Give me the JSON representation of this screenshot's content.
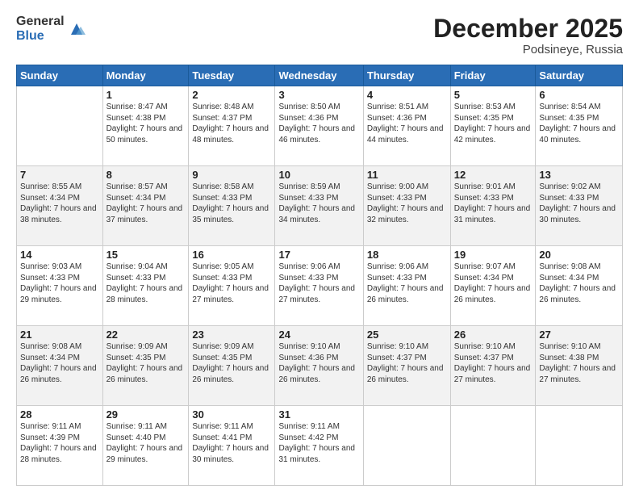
{
  "logo": {
    "general": "General",
    "blue": "Blue"
  },
  "header": {
    "month": "December 2025",
    "location": "Podsineye, Russia"
  },
  "days": [
    "Sunday",
    "Monday",
    "Tuesday",
    "Wednesday",
    "Thursday",
    "Friday",
    "Saturday"
  ],
  "weeks": [
    [
      {
        "day": "",
        "sunrise": "",
        "sunset": "",
        "daylight": ""
      },
      {
        "day": "1",
        "sunrise": "Sunrise: 8:47 AM",
        "sunset": "Sunset: 4:38 PM",
        "daylight": "Daylight: 7 hours and 50 minutes."
      },
      {
        "day": "2",
        "sunrise": "Sunrise: 8:48 AM",
        "sunset": "Sunset: 4:37 PM",
        "daylight": "Daylight: 7 hours and 48 minutes."
      },
      {
        "day": "3",
        "sunrise": "Sunrise: 8:50 AM",
        "sunset": "Sunset: 4:36 PM",
        "daylight": "Daylight: 7 hours and 46 minutes."
      },
      {
        "day": "4",
        "sunrise": "Sunrise: 8:51 AM",
        "sunset": "Sunset: 4:36 PM",
        "daylight": "Daylight: 7 hours and 44 minutes."
      },
      {
        "day": "5",
        "sunrise": "Sunrise: 8:53 AM",
        "sunset": "Sunset: 4:35 PM",
        "daylight": "Daylight: 7 hours and 42 minutes."
      },
      {
        "day": "6",
        "sunrise": "Sunrise: 8:54 AM",
        "sunset": "Sunset: 4:35 PM",
        "daylight": "Daylight: 7 hours and 40 minutes."
      }
    ],
    [
      {
        "day": "7",
        "sunrise": "Sunrise: 8:55 AM",
        "sunset": "Sunset: 4:34 PM",
        "daylight": "Daylight: 7 hours and 38 minutes."
      },
      {
        "day": "8",
        "sunrise": "Sunrise: 8:57 AM",
        "sunset": "Sunset: 4:34 PM",
        "daylight": "Daylight: 7 hours and 37 minutes."
      },
      {
        "day": "9",
        "sunrise": "Sunrise: 8:58 AM",
        "sunset": "Sunset: 4:33 PM",
        "daylight": "Daylight: 7 hours and 35 minutes."
      },
      {
        "day": "10",
        "sunrise": "Sunrise: 8:59 AM",
        "sunset": "Sunset: 4:33 PM",
        "daylight": "Daylight: 7 hours and 34 minutes."
      },
      {
        "day": "11",
        "sunrise": "Sunrise: 9:00 AM",
        "sunset": "Sunset: 4:33 PM",
        "daylight": "Daylight: 7 hours and 32 minutes."
      },
      {
        "day": "12",
        "sunrise": "Sunrise: 9:01 AM",
        "sunset": "Sunset: 4:33 PM",
        "daylight": "Daylight: 7 hours and 31 minutes."
      },
      {
        "day": "13",
        "sunrise": "Sunrise: 9:02 AM",
        "sunset": "Sunset: 4:33 PM",
        "daylight": "Daylight: 7 hours and 30 minutes."
      }
    ],
    [
      {
        "day": "14",
        "sunrise": "Sunrise: 9:03 AM",
        "sunset": "Sunset: 4:33 PM",
        "daylight": "Daylight: 7 hours and 29 minutes."
      },
      {
        "day": "15",
        "sunrise": "Sunrise: 9:04 AM",
        "sunset": "Sunset: 4:33 PM",
        "daylight": "Daylight: 7 hours and 28 minutes."
      },
      {
        "day": "16",
        "sunrise": "Sunrise: 9:05 AM",
        "sunset": "Sunset: 4:33 PM",
        "daylight": "Daylight: 7 hours and 27 minutes."
      },
      {
        "day": "17",
        "sunrise": "Sunrise: 9:06 AM",
        "sunset": "Sunset: 4:33 PM",
        "daylight": "Daylight: 7 hours and 27 minutes."
      },
      {
        "day": "18",
        "sunrise": "Sunrise: 9:06 AM",
        "sunset": "Sunset: 4:33 PM",
        "daylight": "Daylight: 7 hours and 26 minutes."
      },
      {
        "day": "19",
        "sunrise": "Sunrise: 9:07 AM",
        "sunset": "Sunset: 4:34 PM",
        "daylight": "Daylight: 7 hours and 26 minutes."
      },
      {
        "day": "20",
        "sunrise": "Sunrise: 9:08 AM",
        "sunset": "Sunset: 4:34 PM",
        "daylight": "Daylight: 7 hours and 26 minutes."
      }
    ],
    [
      {
        "day": "21",
        "sunrise": "Sunrise: 9:08 AM",
        "sunset": "Sunset: 4:34 PM",
        "daylight": "Daylight: 7 hours and 26 minutes."
      },
      {
        "day": "22",
        "sunrise": "Sunrise: 9:09 AM",
        "sunset": "Sunset: 4:35 PM",
        "daylight": "Daylight: 7 hours and 26 minutes."
      },
      {
        "day": "23",
        "sunrise": "Sunrise: 9:09 AM",
        "sunset": "Sunset: 4:35 PM",
        "daylight": "Daylight: 7 hours and 26 minutes."
      },
      {
        "day": "24",
        "sunrise": "Sunrise: 9:10 AM",
        "sunset": "Sunset: 4:36 PM",
        "daylight": "Daylight: 7 hours and 26 minutes."
      },
      {
        "day": "25",
        "sunrise": "Sunrise: 9:10 AM",
        "sunset": "Sunset: 4:37 PM",
        "daylight": "Daylight: 7 hours and 26 minutes."
      },
      {
        "day": "26",
        "sunrise": "Sunrise: 9:10 AM",
        "sunset": "Sunset: 4:37 PM",
        "daylight": "Daylight: 7 hours and 27 minutes."
      },
      {
        "day": "27",
        "sunrise": "Sunrise: 9:10 AM",
        "sunset": "Sunset: 4:38 PM",
        "daylight": "Daylight: 7 hours and 27 minutes."
      }
    ],
    [
      {
        "day": "28",
        "sunrise": "Sunrise: 9:11 AM",
        "sunset": "Sunset: 4:39 PM",
        "daylight": "Daylight: 7 hours and 28 minutes."
      },
      {
        "day": "29",
        "sunrise": "Sunrise: 9:11 AM",
        "sunset": "Sunset: 4:40 PM",
        "daylight": "Daylight: 7 hours and 29 minutes."
      },
      {
        "day": "30",
        "sunrise": "Sunrise: 9:11 AM",
        "sunset": "Sunset: 4:41 PM",
        "daylight": "Daylight: 7 hours and 30 minutes."
      },
      {
        "day": "31",
        "sunrise": "Sunrise: 9:11 AM",
        "sunset": "Sunset: 4:42 PM",
        "daylight": "Daylight: 7 hours and 31 minutes."
      },
      {
        "day": "",
        "sunrise": "",
        "sunset": "",
        "daylight": ""
      },
      {
        "day": "",
        "sunrise": "",
        "sunset": "",
        "daylight": ""
      },
      {
        "day": "",
        "sunrise": "",
        "sunset": "",
        "daylight": ""
      }
    ]
  ]
}
